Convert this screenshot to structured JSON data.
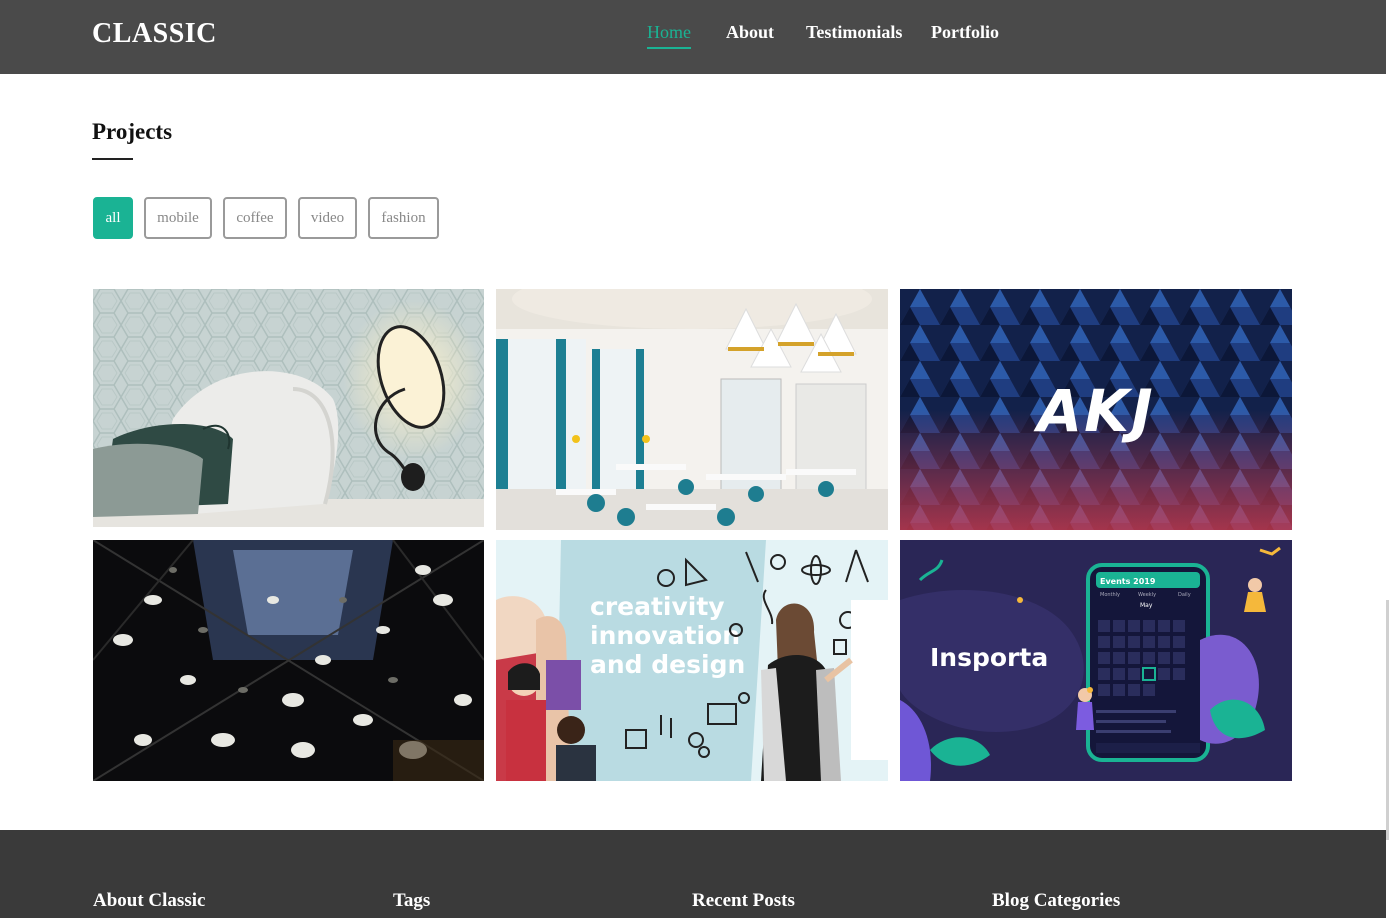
{
  "brand": "CLASSIC",
  "nav": {
    "items": [
      {
        "label": "Home",
        "active": true
      },
      {
        "label": "About",
        "active": false
      },
      {
        "label": "Testimonials",
        "active": false
      },
      {
        "label": "Portfolio",
        "active": false
      }
    ]
  },
  "projects": {
    "title": "Projects",
    "filters": [
      {
        "label": "all",
        "active": true
      },
      {
        "label": "mobile",
        "active": false
      },
      {
        "label": "coffee",
        "active": false
      },
      {
        "label": "video",
        "active": false
      },
      {
        "label": "fashion",
        "active": false
      }
    ],
    "items": [
      {
        "image": "bedroom wall lamp"
      },
      {
        "image": "cafe interior"
      },
      {
        "image": "AKJ logo on geometric pattern",
        "logo_text": "AKJ"
      },
      {
        "image": "atrium ceiling installation"
      },
      {
        "image": "creativity innovation design banner",
        "line1": "creativity",
        "line2": "innovation",
        "line3": "and design"
      },
      {
        "image": "Insporta app promo",
        "brand": "Insporta",
        "phone_title": "Events 2019",
        "phone_tabs": [
          "Monthly",
          "Weekly",
          "Daily"
        ],
        "month": "May"
      }
    ]
  },
  "footer": {
    "headings": [
      "About Classic",
      "Tags",
      "Recent Posts",
      "Blog Categories"
    ]
  },
  "colors": {
    "accent": "#1ab394",
    "navbar": "#4a4a4a",
    "footer": "#3a3a3a"
  }
}
